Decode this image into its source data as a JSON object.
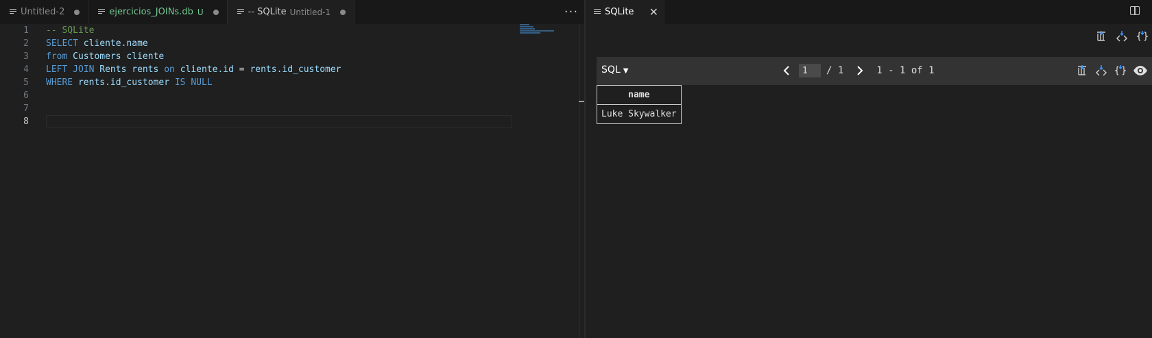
{
  "left_tabs": [
    {
      "label": "Untitled-2",
      "desc": "",
      "badge": "",
      "dirty": true
    },
    {
      "label": "ejercicios_JOINs.db",
      "desc": "",
      "badge": "U",
      "dirty": true
    },
    {
      "label": "-- SQLite",
      "desc": "Untitled-1",
      "badge": "",
      "dirty": true
    }
  ],
  "left_more": "···",
  "editor": {
    "line_numbers": [
      "1",
      "2",
      "3",
      "4",
      "5",
      "6",
      "7",
      "8"
    ],
    "current_line": "8",
    "lines": [
      [
        {
          "t": "-- SQLite",
          "c": "comment"
        }
      ],
      [
        {
          "t": "SELECT ",
          "c": "kw"
        },
        {
          "t": "cliente.name",
          "c": "id"
        }
      ],
      [
        {
          "t": "from ",
          "c": "kw"
        },
        {
          "t": "Customers cliente",
          "c": "id"
        }
      ],
      [
        {
          "t": "LEFT JOIN ",
          "c": "kw"
        },
        {
          "t": "Rents rents ",
          "c": "id"
        },
        {
          "t": "on ",
          "c": "kw"
        },
        {
          "t": "cliente.id",
          "c": "id"
        },
        {
          "t": " = ",
          "c": "plain"
        },
        {
          "t": "rents.id_customer",
          "c": "id"
        }
      ],
      [
        {
          "t": "WHERE ",
          "c": "kw"
        },
        {
          "t": "rents.id_customer ",
          "c": "id"
        },
        {
          "t": "IS NULL",
          "c": "kw"
        }
      ],
      [],
      [],
      []
    ]
  },
  "right_tab": {
    "label": "SQLite",
    "close": "✕"
  },
  "results": {
    "dialect": "SQL",
    "page_value": "1",
    "page_total": "/ 1",
    "range_text": "1 - 1 of 1",
    "columns": [
      "name"
    ],
    "rows": [
      [
        "Luke Skywalker"
      ]
    ]
  },
  "icons": {
    "prev": "chevron-left-icon",
    "next": "chevron-right-icon",
    "export_csv": "export-csv-icon",
    "export_json": "export-json-icon",
    "open_json": "open-json-icon",
    "preview": "eye-icon"
  }
}
